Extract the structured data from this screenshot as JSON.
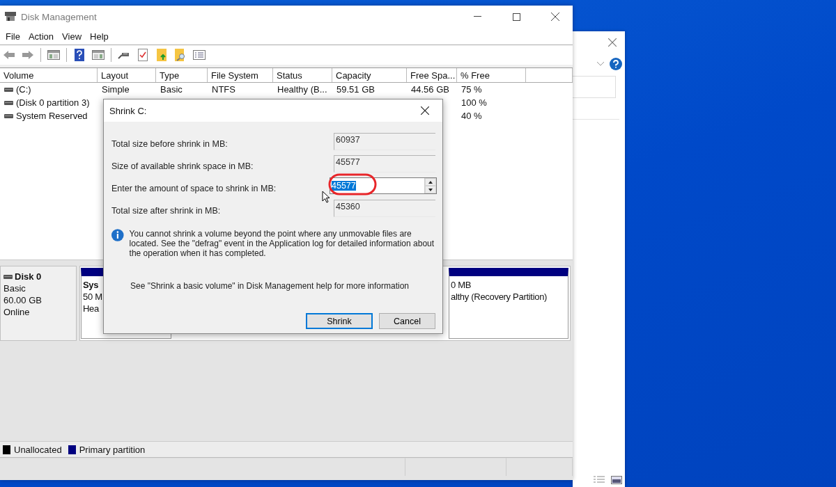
{
  "window": {
    "title": "Disk Management"
  },
  "menu": [
    "File",
    "Action",
    "View",
    "Help"
  ],
  "volume_table": {
    "columns": [
      "Volume",
      "Layout",
      "Type",
      "File System",
      "Status",
      "Capacity",
      "Free Spa...",
      "% Free"
    ],
    "rows": [
      {
        "volume": "(C:)",
        "layout": "Simple",
        "type": "Basic",
        "file_system": "NTFS",
        "status": "Healthy (B...",
        "capacity": "59.51 GB",
        "free_space": "44.56 GB",
        "percent_free": "75 %"
      },
      {
        "volume": "(Disk 0 partition 3)",
        "percent_free": "100 %"
      },
      {
        "volume": "System Reserved",
        "percent_free": "40 %"
      }
    ]
  },
  "disk": {
    "name": "Disk 0",
    "type": "Basic",
    "size": "60.00 GB",
    "status": "Online",
    "partitions": [
      {
        "name": "Sys",
        "lines": [
          "50 M",
          "Hea"
        ]
      },
      {
        "lines": [
          "0 MB",
          "althy (Recovery Partition)"
        ]
      }
    ]
  },
  "legend": [
    {
      "label": "Unallocated",
      "color": "#000000"
    },
    {
      "label": "Primary partition",
      "color": "#000080"
    }
  ],
  "dialog": {
    "title": "Shrink C:",
    "fields": [
      {
        "kind": "readonly",
        "label": "Total size before shrink in MB:",
        "value": "60937"
      },
      {
        "kind": "readonly",
        "label": "Size of available shrink space in MB:",
        "value": "45577"
      },
      {
        "kind": "spin",
        "label": "Enter the amount of space to shrink in MB:",
        "value": "45577",
        "selected": true
      },
      {
        "kind": "readonly",
        "label": "Total size after shrink in MB:",
        "value": "45360"
      }
    ],
    "info": "You cannot shrink a volume beyond the point where any unmovable files are located. See the \"defrag\" event in the Application log for detailed information about the operation when it has completed.",
    "help": "See \"Shrink a basic volume\" in Disk Management help for more information",
    "buttons": [
      {
        "label": "Shrink",
        "default": true
      },
      {
        "label": "Cancel",
        "default": false
      }
    ]
  }
}
